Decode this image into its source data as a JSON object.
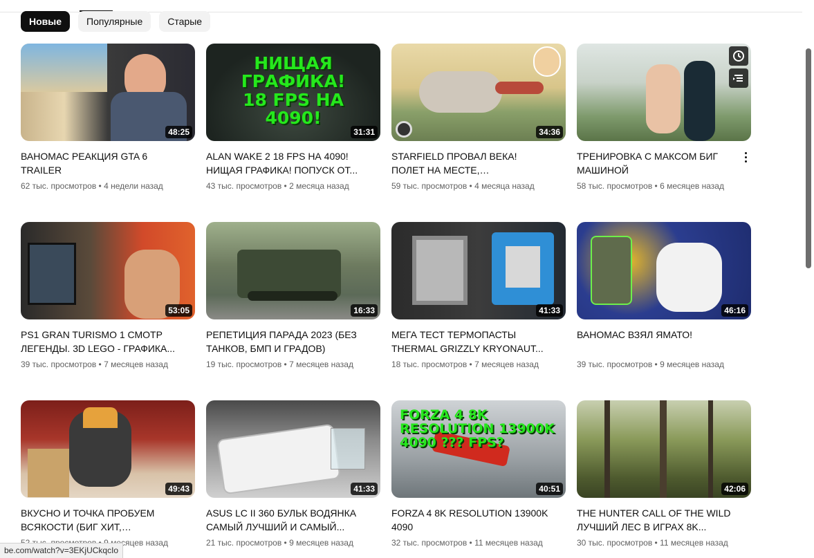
{
  "filters": {
    "chips": [
      {
        "label": "Новые",
        "active": true
      },
      {
        "label": "Популярные",
        "active": false
      },
      {
        "label": "Старые",
        "active": false
      }
    ]
  },
  "videos": [
    {
      "title": "ВАНОМАС РЕАКЦИЯ GTA 6 TRAILER",
      "views": "62 тыс. просмотров",
      "age": "4 недели назад",
      "duration": "48:25"
    },
    {
      "title": "ALAN WAKE 2 18 FPS НА 4090! НИЩАЯ ГРАФИКА! ПОПУСК ОТ...",
      "views": "43 тыс. просмотров",
      "age": "2 месяца назад",
      "duration": "31:31",
      "thumb_text": "НИЩАЯ ГРАФИКА! 18 FPS НА 4090!"
    },
    {
      "title": "STARFIELD ПРОВАЛ ВЕКА! ПОЛЕТ НА МЕСТЕ, МАКСИМАЛЬНО...",
      "views": "59 тыс. просмотров",
      "age": "4 месяца назад",
      "duration": "34:36"
    },
    {
      "title": "ТРЕНИРОВКА С МАКСОМ БИГ МАШИНОЙ",
      "views": "58 тыс. просмотров",
      "age": "6 месяцев назад",
      "duration": ""
    },
    {
      "title": "PS1 GRAN TURISMO 1 СМОТР ЛЕГЕНДЫ. 3D LEGO - ГРАФИКА...",
      "views": "39 тыс. просмотров",
      "age": "7 месяцев назад",
      "duration": "53:05"
    },
    {
      "title": "РЕПЕТИЦИЯ ПАРАДА 2023 (БЕЗ ТАНКОВ, БМП И ГРАДОВ)",
      "views": "19 тыс. просмотров",
      "age": "7 месяцев назад",
      "duration": "16:33"
    },
    {
      "title": "МЕГА ТЕСТ ТЕРМОПАСТЫ THERMAL GRIZZLY KRYONAUT...",
      "views": "18 тыс. просмотров",
      "age": "7 месяцев назад",
      "duration": "41:33"
    },
    {
      "title": "ВАНОМАС ВЗЯЛ ЯМАТО!",
      "views": "39 тыс. просмотров",
      "age": "9 месяцев назад",
      "duration": "46:16"
    },
    {
      "title": "ВКУСНО И ТОЧКА ПРОБУЕМ ВСЯКОСТИ (БИГ ХИТ, МОНБЛАН,...",
      "views": "52 тыс. просмотров",
      "age": "9 месяцев назад",
      "duration": "49:43"
    },
    {
      "title": "ASUS LC II 360 БУЛЬК ВОДЯНКА САМЫЙ ЛУЧШИЙ И САМЫЙ...",
      "views": "21 тыс. просмотров",
      "age": "9 месяцев назад",
      "duration": "41:33"
    },
    {
      "title": "FORZA 4 8K RESOLUTION 13900K 4090",
      "views": "32 тыс. просмотров",
      "age": "11 месяцев назад",
      "duration": "40:51",
      "thumb_text": "FORZA 4 8K RESOLUTION 13900K 4090 ??? FPS?"
    },
    {
      "title": "THE HUNTER CALL OF THE WILD ЛУЧШИЙ ЛЕС В ИГРАХ 8K...",
      "views": "30 тыс. просмотров",
      "age": "11 месяцев назад",
      "duration": "42:06"
    }
  ],
  "status_url": "be.com/watch?v=3EKjUCkqcIo",
  "colors": {
    "chip_active_bg": "#0f0f0f",
    "chip_bg": "#f2f2f2",
    "meta_text": "#606060",
    "thumb_green_text": "#25e81c"
  },
  "icons": {
    "watch_later": "clock-icon",
    "add_to_queue": "queue-icon",
    "more": "more-vert-icon"
  }
}
